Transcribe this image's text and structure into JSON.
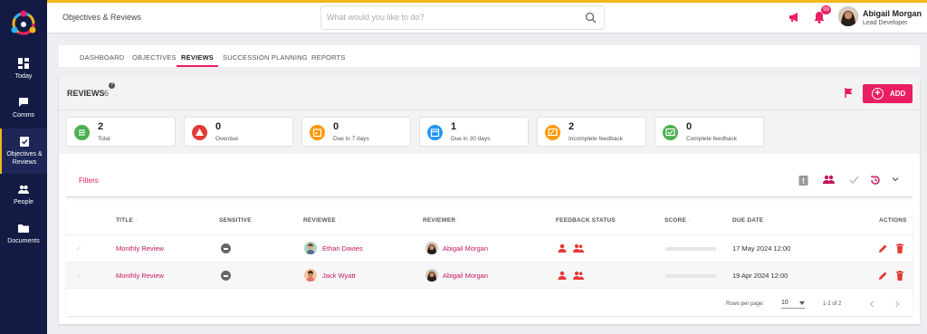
{
  "app": {
    "title": "Objectives & Reviews"
  },
  "search": {
    "placeholder": "What would you like to do?"
  },
  "notifications": {
    "count": "99"
  },
  "user": {
    "name": "Abigail Morgan",
    "role": "Lead Developer"
  },
  "sidebar": {
    "items": [
      {
        "label": "Today",
        "icon": "dashboard-icon"
      },
      {
        "label": "Comms",
        "icon": "chat-icon"
      },
      {
        "label": "Objectives & Reviews",
        "icon": "clipboard-check-icon",
        "active": true
      },
      {
        "label": "People",
        "icon": "people-icon"
      },
      {
        "label": "Documents",
        "icon": "folder-icon"
      }
    ]
  },
  "tabs": [
    {
      "label": "DASHBOARD"
    },
    {
      "label": "OBJECTIVES"
    },
    {
      "label": "REVIEWS",
      "active": true
    },
    {
      "label": "SUCCESSION PLANNING"
    },
    {
      "label": "REPORTS"
    }
  ],
  "reviews": {
    "title": "REVIEWS",
    "count": "6",
    "help": "?",
    "add_label": "ADD",
    "add_plus": "+"
  },
  "stats": [
    {
      "value": "2",
      "label": "Total",
      "color": "#4caf50"
    },
    {
      "value": "0",
      "label": "Overdue",
      "color": "#e53935"
    },
    {
      "value": "0",
      "label": "Due in 7 days",
      "color": "#ff9800"
    },
    {
      "value": "1",
      "label": "Due in 30 days",
      "color": "#2196f3"
    },
    {
      "value": "2",
      "label": "Incomplete feedback",
      "color": "#ff9800"
    },
    {
      "value": "0",
      "label": "Complete feedback",
      "color": "#4caf50"
    }
  ],
  "filters": {
    "label": "Filters"
  },
  "table": {
    "headers": {
      "title": "TITLE",
      "sensitive": "SENSITIVE",
      "reviewee": "REVIEWEE",
      "reviewer": "REVIEWER",
      "feedback_status": "FEEDBACK STATUS",
      "score": "SCORE",
      "due_date": "DUE DATE",
      "actions": "ACTIONS"
    },
    "rows": [
      {
        "check": "✓",
        "title": "Monthly Review",
        "reviewee": "Ethan Davies",
        "reviewer": "Abigail Morgan",
        "due_date": "17 May 2024 12:00"
      },
      {
        "check": "✓",
        "title": "Monthly Review",
        "reviewee": "Jack Wyatt",
        "reviewer": "Abigail Morgan",
        "due_date": "19 Apr 2024 12:00"
      }
    ]
  },
  "pagination": {
    "rows_per_page_label": "Rows per page:",
    "rows_per_page_value": "10",
    "range": "1-2 of 2"
  },
  "colors": {
    "accent": "#e91e63",
    "sidebar": "#131b45",
    "topline": "#f2b51c"
  }
}
